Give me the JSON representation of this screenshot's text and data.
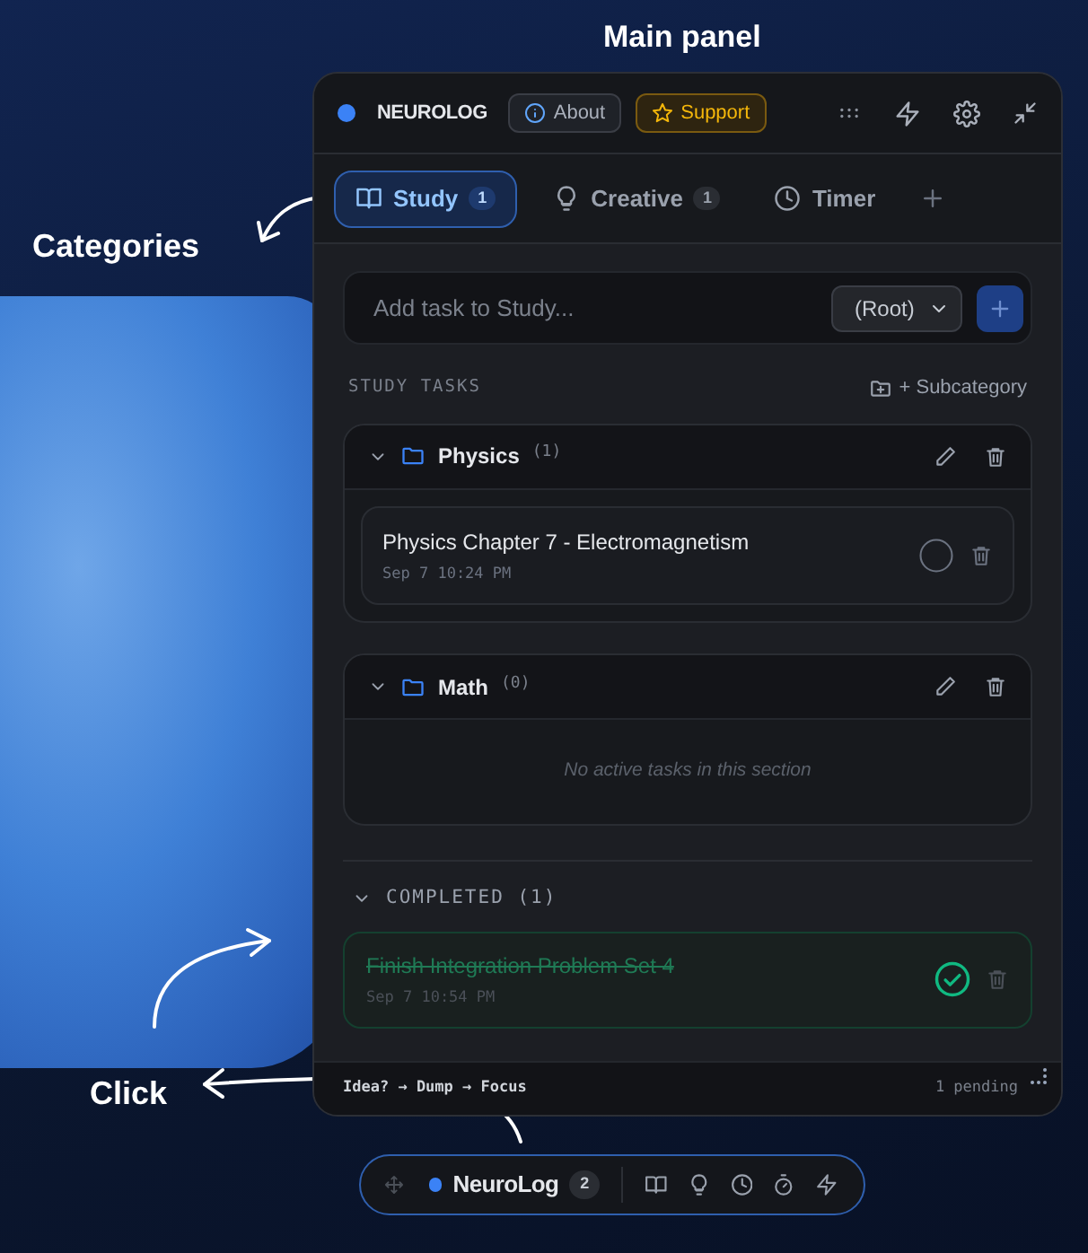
{
  "annotations": [
    {
      "text": "Main panel"
    },
    {
      "text": "Categories"
    },
    {
      "text": "Click"
    }
  ],
  "panel": {
    "brand": "NEUROLOG",
    "about": "About",
    "support": "Support"
  },
  "tabs": [
    {
      "kind": "book",
      "label": "Study",
      "count": "1",
      "selected": true
    },
    {
      "kind": "bulb",
      "label": "Creative",
      "count": "1",
      "selected": false
    },
    {
      "kind": "clock",
      "label": "Timer",
      "selected": false
    }
  ],
  "task_input": {
    "placeholder": "Add task to Study...",
    "parent": "(Root)"
  },
  "section_title": "STUDY TASKS",
  "subcategory_link": "+ Subcategory",
  "subcategories": [
    {
      "name": "Physics",
      "count": "(1)",
      "expanded": true,
      "tasks": [
        {
          "title": "Physics Chapter 7 - Electromagnetism",
          "time": "Sep 7 10:24 PM",
          "done": false
        }
      ]
    },
    {
      "name": "Math",
      "count": "(0)",
      "expanded": true,
      "empty_text": "No active tasks in this section"
    }
  ],
  "completed": {
    "label": "COMPLETED (1)",
    "expanded": true,
    "tasks": [
      {
        "title": "Finish Integration Problem Set 4",
        "time": "Sep 7 10:54 PM",
        "done": true
      }
    ]
  },
  "footer": {
    "flow": "Idea? → Dump → Focus",
    "pending": "1 pending"
  },
  "floating_bar": {
    "name": "NeuroLog",
    "count": "2"
  }
}
